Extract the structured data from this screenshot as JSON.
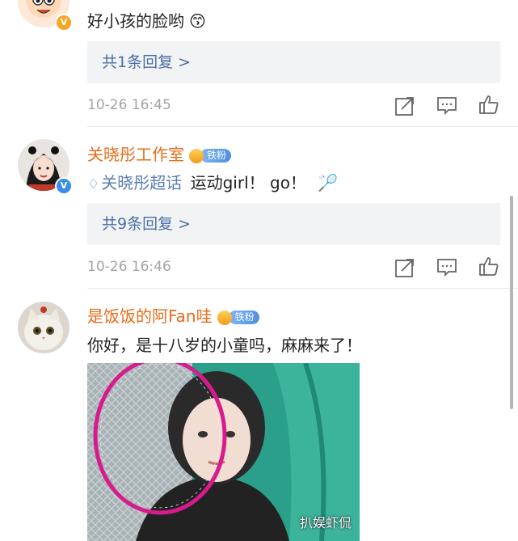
{
  "comments": [
    {
      "comment_text": "好小孩的脸哟",
      "emoji": "😙",
      "reply_label": "共1条回复 >",
      "timestamp": "10-26 16:45"
    },
    {
      "username": "关晓彤工作室",
      "fan_badge": "铁粉",
      "super_topic": "关晓彤超话",
      "comment_text": "运动girl！ go！",
      "emoji": "🏸",
      "reply_label": "共9条回复 >",
      "timestamp": "10-26 16:46"
    },
    {
      "username": "是饭饭的阿Fan哇",
      "fan_badge": "铁粉",
      "comment_text": "你好，是十八岁的小童吗，麻麻来了！"
    }
  ],
  "watermark": "扒娱虾侃",
  "colors": {
    "username": "#e86c19",
    "reply_link": "#4a6fa5",
    "super_topic": "#5b7fb3",
    "timestamp": "#a4a4a4",
    "reply_bg": "#f2f3f5",
    "verified_gold": "#f5a623",
    "verified_blue": "#3a8ee6"
  },
  "icons": [
    "share-icon",
    "comment-icon",
    "like-icon",
    "diamond-icon",
    "crown-icon",
    "verified-icon"
  ]
}
